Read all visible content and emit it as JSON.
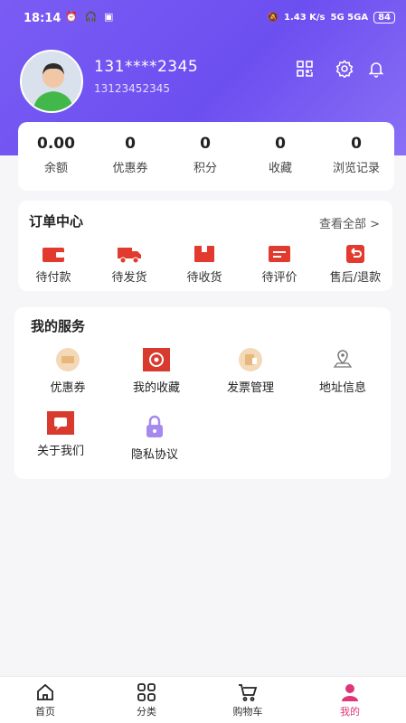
{
  "status_bar": {
    "time": "18:14",
    "speed": "1.43 K/s",
    "network": "5G 5GA",
    "battery": "84"
  },
  "profile": {
    "name": "131****2345",
    "phone": "13123452345"
  },
  "header_icons": [
    "qr-code-icon",
    "settings-icon",
    "bell-icon"
  ],
  "stats": [
    {
      "value": "0.00",
      "label": "余额"
    },
    {
      "value": "0",
      "label": "优惠券"
    },
    {
      "value": "0",
      "label": "积分"
    },
    {
      "value": "0",
      "label": "收藏"
    },
    {
      "value": "0",
      "label": "浏览记录"
    }
  ],
  "orders": {
    "title": "订单中心",
    "view_all": "查看全部 >",
    "items": [
      {
        "label": "待付款",
        "icon": "wallet-icon"
      },
      {
        "label": "待发货",
        "icon": "truck-icon"
      },
      {
        "label": "待收货",
        "icon": "package-icon"
      },
      {
        "label": "待评价",
        "icon": "comment-icon"
      },
      {
        "label": "售后/退款",
        "icon": "refund-icon"
      }
    ]
  },
  "services": {
    "title": "我的服务",
    "items": [
      {
        "label": "优惠券",
        "icon": "coupon-icon"
      },
      {
        "label": "我的收藏",
        "icon": "favorites-icon"
      },
      {
        "label": "发票管理",
        "icon": "invoice-icon"
      },
      {
        "label": "地址信息",
        "icon": "location-icon"
      },
      {
        "label": "关于我们",
        "icon": "about-icon"
      },
      {
        "label": "隐私协议",
        "icon": "lock-icon"
      }
    ]
  },
  "tabbar": [
    {
      "label": "首页",
      "icon": "home-icon"
    },
    {
      "label": "分类",
      "icon": "category-icon"
    },
    {
      "label": "购物车",
      "icon": "cart-icon"
    },
    {
      "label": "我的",
      "icon": "profile-icon",
      "active": true
    }
  ],
  "colors": {
    "primary": "#6c4ff0",
    "accent_red": "#e23a2e",
    "active_tab": "#e0357a"
  }
}
